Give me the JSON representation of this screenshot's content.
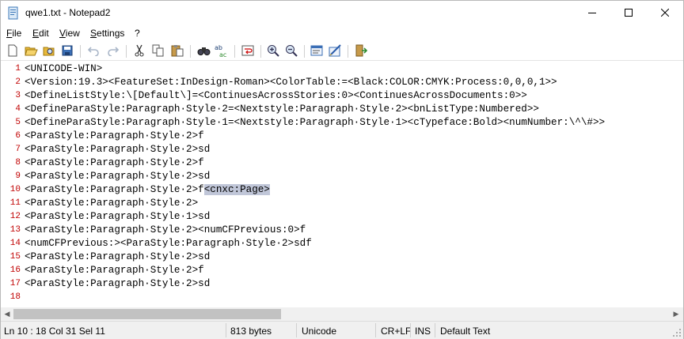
{
  "window": {
    "title": "qwe1.txt - Notepad2",
    "controls": {
      "minimize": "minimize-icon",
      "maximize": "maximize-icon",
      "close": "close-icon"
    }
  },
  "menu": {
    "items": [
      {
        "label": "File"
      },
      {
        "label": "Edit"
      },
      {
        "label": "View"
      },
      {
        "label": "Settings"
      },
      {
        "label": "?"
      }
    ]
  },
  "toolbar": {
    "buttons": [
      {
        "icon": "new-file-icon"
      },
      {
        "icon": "open-file-icon"
      },
      {
        "icon": "browse-icon"
      },
      {
        "icon": "save-icon"
      },
      {
        "icon": "undo-icon"
      },
      {
        "icon": "redo-icon"
      },
      {
        "icon": "cut-icon"
      },
      {
        "icon": "copy-icon"
      },
      {
        "icon": "paste-icon"
      },
      {
        "icon": "find-icon"
      },
      {
        "icon": "replace-icon"
      },
      {
        "icon": "wordwrap-icon"
      },
      {
        "icon": "zoom-in-icon"
      },
      {
        "icon": "zoom-out-icon"
      },
      {
        "icon": "scheme-icon"
      },
      {
        "icon": "customize-scheme-icon"
      },
      {
        "icon": "exit-icon"
      }
    ]
  },
  "editor": {
    "selected_line": 10,
    "lines": [
      {
        "num": "1",
        "text": "<UNICODE-WIN>"
      },
      {
        "num": "2",
        "text": "<Version:19.3><FeatureSet:InDesign-Roman><ColorTable:=<Black:COLOR:CMYK:Process:0,0,0,1>>"
      },
      {
        "num": "3",
        "text": "<DefineListStyle:\\[Default\\]=<ContinuesAcrossStories:0><ContinuesAcrossDocuments:0>>"
      },
      {
        "num": "4",
        "text": "<DefineParaStyle:Paragraph·Style·2=<Nextstyle:Paragraph·Style·2><bnListType:Numbered>>"
      },
      {
        "num": "5",
        "text": "<DefineParaStyle:Paragraph·Style·1=<Nextstyle:Paragraph·Style·1><cTypeface:Bold><numNumber:\\^\\#>>"
      },
      {
        "num": "6",
        "text": "<ParaStyle:Paragraph·Style·2>f"
      },
      {
        "num": "7",
        "text": "<ParaStyle:Paragraph·Style·2>sd"
      },
      {
        "num": "8",
        "text": "<ParaStyle:Paragraph·Style·2>f"
      },
      {
        "num": "9",
        "text": "<ParaStyle:Paragraph·Style·2>sd"
      },
      {
        "num": "10",
        "text": "<ParaStyle:Paragraph·Style·2>f",
        "selected": "<cnxc:Page>"
      },
      {
        "num": "11",
        "text": "<ParaStyle:Paragraph·Style·2>"
      },
      {
        "num": "12",
        "text": "<ParaStyle:Paragraph·Style·1>sd"
      },
      {
        "num": "13",
        "text": "<ParaStyle:Paragraph·Style·2><numCFPrevious:0>f"
      },
      {
        "num": "14",
        "text": "<numCFPrevious:><ParaStyle:Paragraph·Style·2>sdf"
      },
      {
        "num": "15",
        "text": "<ParaStyle:Paragraph·Style·2>sd"
      },
      {
        "num": "16",
        "text": "<ParaStyle:Paragraph·Style·2>f"
      },
      {
        "num": "17",
        "text": "<ParaStyle:Paragraph·Style·2>sd"
      },
      {
        "num": "18",
        "text": ""
      }
    ]
  },
  "status": {
    "position": "Ln 10 : 18   Col 31   Sel 11",
    "size": "813 bytes",
    "encoding": "Unicode",
    "line_endings": "CR+LF",
    "insert_mode": "INS",
    "scheme": "Default Text"
  },
  "colors": {
    "line_number": "#c00000",
    "selection": "#c0c6d8",
    "statusbar_bg": "#f0f0f0"
  }
}
